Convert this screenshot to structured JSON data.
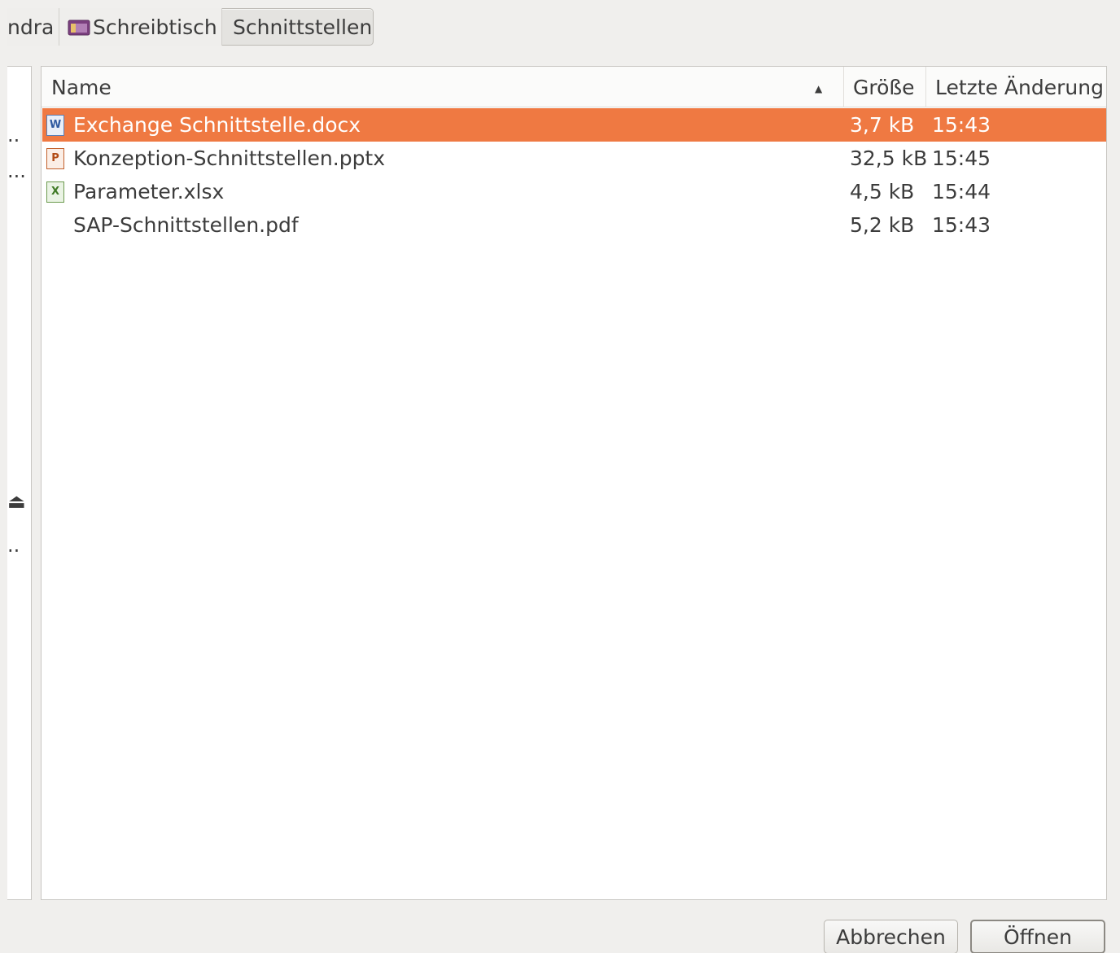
{
  "pathbar": {
    "crumbs": [
      {
        "label": "ndra"
      },
      {
        "label": "Schreibtisch",
        "icon": "desktop-folder-icon"
      },
      {
        "label": "Schnittstellen",
        "active": true
      }
    ]
  },
  "file_list": {
    "columns": {
      "name": "Name",
      "size": "Größe",
      "modified": "Letzte Änderung"
    },
    "sort_indicator": "▲",
    "rows": [
      {
        "name": "Exchange Schnittstelle.docx",
        "size": "3,7 kB",
        "modified": "15:43",
        "icon": "word-document-icon",
        "icon_glyph": "W",
        "selected": true
      },
      {
        "name": "Konzeption-Schnittstellen.pptx",
        "size": "32,5 kB",
        "modified": "15:45",
        "icon": "powerpoint-document-icon",
        "icon_glyph": "P",
        "selected": false
      },
      {
        "name": "Parameter.xlsx",
        "size": "4,5 kB",
        "modified": "15:44",
        "icon": "excel-document-icon",
        "icon_glyph": "X",
        "selected": false
      },
      {
        "name": "SAP-Schnittstellen.pdf",
        "size": "5,2 kB",
        "modified": "15:43",
        "icon": "",
        "icon_glyph": "",
        "selected": false
      }
    ]
  },
  "sidebar": {
    "glyphs": [
      "..",
      "...",
      "⏏",
      ".."
    ]
  },
  "buttons": {
    "cancel": "Abbrechen",
    "open": "Öffnen"
  },
  "colors": {
    "selection": "#ef7942",
    "window_bg": "#f0efed"
  }
}
